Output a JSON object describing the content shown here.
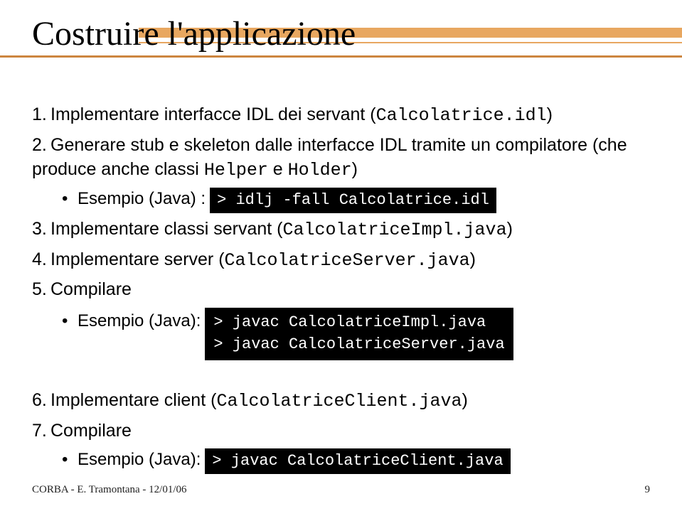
{
  "title": "Costruire l'applicazione",
  "items": {
    "1": {
      "n": "1.",
      "text_pre": "Implementare interfacce IDL dei servant (",
      "code": "Calcolatrice.idl",
      "text_post": ")"
    },
    "2": {
      "n": "2.",
      "text_pre": "Generare stub e skeleton dalle interfacce IDL tramite un compilatore (che produce anche classi ",
      "code1": "Helper",
      "mid": " e ",
      "code2": "Holder",
      "text_post": ")"
    },
    "2sub": {
      "bullet": "•",
      "label": "Esempio (Java) :",
      "cmd": "> idlj -fall Calcolatrice.idl"
    },
    "3": {
      "n": "3.",
      "text_pre": "Implementare classi servant (",
      "code": "CalcolatriceImpl.java",
      "text_post": ")"
    },
    "4": {
      "n": "4.",
      "text_pre": "Implementare server (",
      "code": "CalcolatriceServer.java",
      "text_post": ")"
    },
    "5": {
      "n": "5.",
      "text": "Compilare"
    },
    "5sub": {
      "bullet": "•",
      "label": "Esempio (Java):",
      "cmd": "> javac CalcolatriceImpl.java\n> javac CalcolatriceServer.java"
    },
    "6": {
      "n": "6.",
      "text_pre": "Implementare client (",
      "code": "CalcolatriceClient.java",
      "text_post": ")"
    },
    "7": {
      "n": "7.",
      "text": "Compilare"
    },
    "7sub": {
      "bullet": "•",
      "label": "Esempio (Java):",
      "cmd": "> javac CalcolatriceClient.java"
    }
  },
  "footer": {
    "left": "CORBA - E. Tramontana - 12/01/06",
    "right": "9"
  }
}
